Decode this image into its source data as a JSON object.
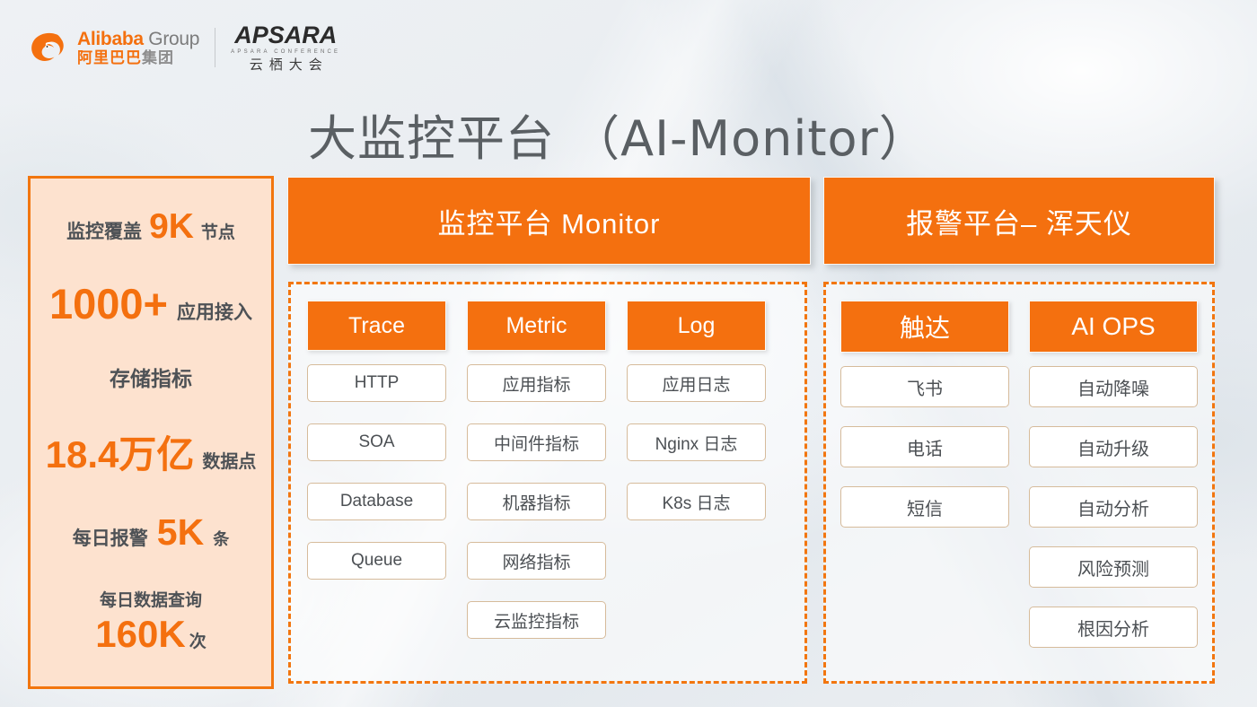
{
  "branding": {
    "alibaba_en_main": "Alibaba",
    "alibaba_en_sub": "Group",
    "alibaba_cn_main": "阿里巴巴",
    "alibaba_cn_sub": "集团",
    "apsara_en": "APSARA",
    "apsara_en_sub": "APSARA CONFERENCE",
    "apsara_cn": "云栖大会"
  },
  "title": "大监控平台 （AI-Monitor）",
  "stats": [
    {
      "label": "监控覆盖",
      "value": "9K",
      "suffix": "节点"
    },
    {
      "label": "",
      "value": "1000+",
      "suffix": "应用接入"
    },
    {
      "label": "存储指标",
      "value": "",
      "suffix": ""
    },
    {
      "label": "",
      "value": "18.4万亿",
      "suffix": "数据点"
    },
    {
      "label": "每日报警",
      "value": "5K",
      "suffix": "条"
    },
    {
      "label": "每日数据查询",
      "value": "160K",
      "suffix": "次"
    }
  ],
  "platforms": [
    {
      "header": "监控平台 Monitor",
      "columns": [
        {
          "title": "Trace",
          "items": [
            "HTTP",
            "SOA",
            "Database",
            "Queue"
          ]
        },
        {
          "title": "Metric",
          "items": [
            "应用指标",
            "中间件指标",
            "机器指标",
            "网络指标",
            "云监控指标"
          ]
        },
        {
          "title": "Log",
          "items": [
            "应用日志",
            "Nginx 日志",
            "K8s 日志"
          ]
        }
      ]
    },
    {
      "header": "报警平台– 浑天仪",
      "columns": [
        {
          "title": "触达",
          "items": [
            "飞书",
            "电话",
            "短信"
          ]
        },
        {
          "title": "AI OPS",
          "items": [
            "自动降噪",
            "自动升级",
            "自动分析",
            "风险预测",
            "根因分析"
          ]
        }
      ]
    }
  ],
  "colors": {
    "accent_orange": "#f4700f",
    "panel_fill": "#fde2cf",
    "pill_border": "#d6bb9b",
    "title_grey": "#5a5f63",
    "background": "#eceff2"
  }
}
